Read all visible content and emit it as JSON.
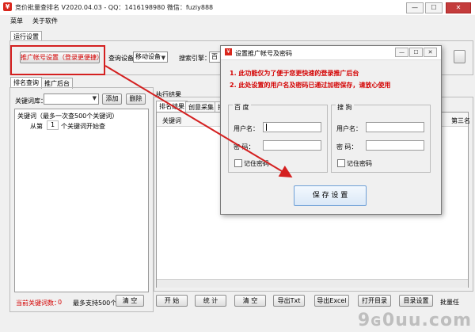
{
  "window": {
    "title": "竞价批量查排名 V2020.04.03 - QQ：1416198980  微信：fuziy888",
    "controls": [
      "—",
      "☐",
      "✕"
    ]
  },
  "menu": [
    "菜单",
    "关于软件"
  ],
  "run_settings": {
    "tab_label": "运行设置",
    "promo_account_button": "推广帐号设置（登录更便捷）",
    "query_device_label": "查询设备：",
    "query_device_value": "移动设备",
    "search_engine_label": "搜索引擎：",
    "search_engine_value": "百"
  },
  "left_panel": {
    "tabs": [
      "排名查询",
      "推广后台"
    ],
    "keyword_lib_label": "关键词库：",
    "add_button": "添加",
    "delete_button": "删除",
    "keyword_header": "关键词（最多一次查500个关键词）",
    "start_from_prefix": "从第",
    "start_from_value": "1",
    "start_from_suffix": "个关键词开始查",
    "current_count_label": "当前关键词数：",
    "current_count_value": "0",
    "max_support": "最多支持500个",
    "clear_button": "清 空"
  },
  "results": {
    "group_label": "执行结果",
    "tabs": [
      "排名结果",
      "创意采集",
      "排"
    ],
    "column_keyword": "关键词",
    "column_right_fragment": "第三名"
  },
  "bottom_buttons": [
    "开 始",
    "统 计",
    "清 空",
    "导出Txt",
    "导出Excel",
    "打开目录",
    "目录设置"
  ],
  "bottom_right_label": "批量任",
  "dialog": {
    "title": "设置推广帐号及密码",
    "notice_1": "1. 此功能仅为了便于您更快速的登录推广后台",
    "notice_2": "2. 此处设置的用户名及密码已通过加密保存，请放心使用",
    "baidu": {
      "label": "百 度",
      "username_label": "用户名：",
      "password_label": "密  码：",
      "remember_label": "记住密码",
      "username_value": "",
      "password_value": ""
    },
    "sogou": {
      "label": "搜 狗",
      "username_label": "用户名：",
      "password_label": "密  码：",
      "remember_label": "记住密码",
      "username_value": "",
      "password_value": ""
    },
    "save_button": "保 存 设 置",
    "controls": [
      "—",
      "☐",
      "✕"
    ]
  },
  "watermark": "9ɢ0uu.com",
  "colors": {
    "red_notice": "#d40000",
    "highlight_box": "#d42020",
    "arrow": "#d42020"
  }
}
